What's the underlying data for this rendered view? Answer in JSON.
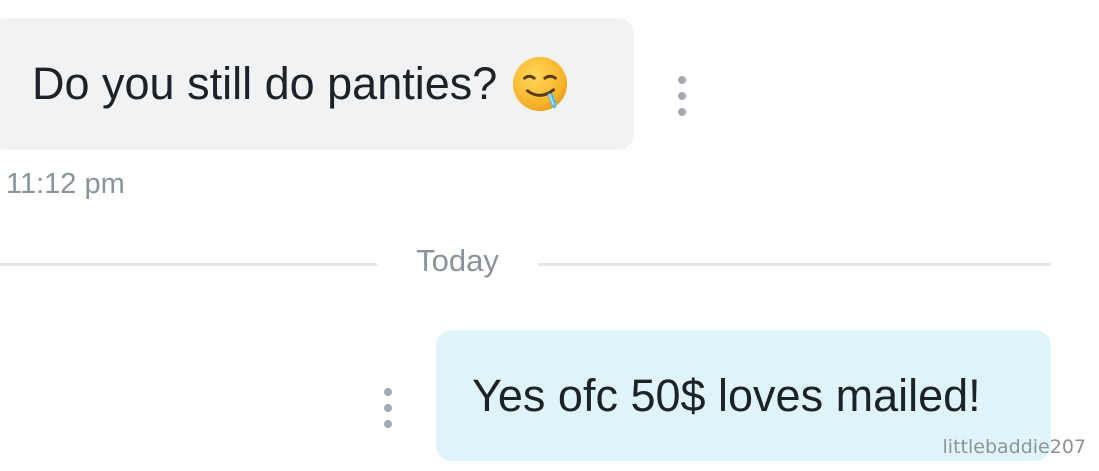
{
  "messages": [
    {
      "direction": "incoming",
      "text": "Do you still do panties?",
      "emoji": "drooling-face-icon",
      "timestamp": "11:12 pm"
    },
    {
      "direction": "outgoing",
      "text": "Yes ofc 50$ loves mailed!"
    }
  ],
  "divider": {
    "label": "Today"
  },
  "watermark": "littlebaddie207",
  "icons": {
    "message_options": "more-vertical-icon"
  },
  "colors": {
    "incoming_bubble": "#f0f2f3",
    "outgoing_bubble": "#def4f9",
    "text": "#1d2228",
    "muted_text": "#8a949c",
    "divider": "#e4e7ea"
  }
}
